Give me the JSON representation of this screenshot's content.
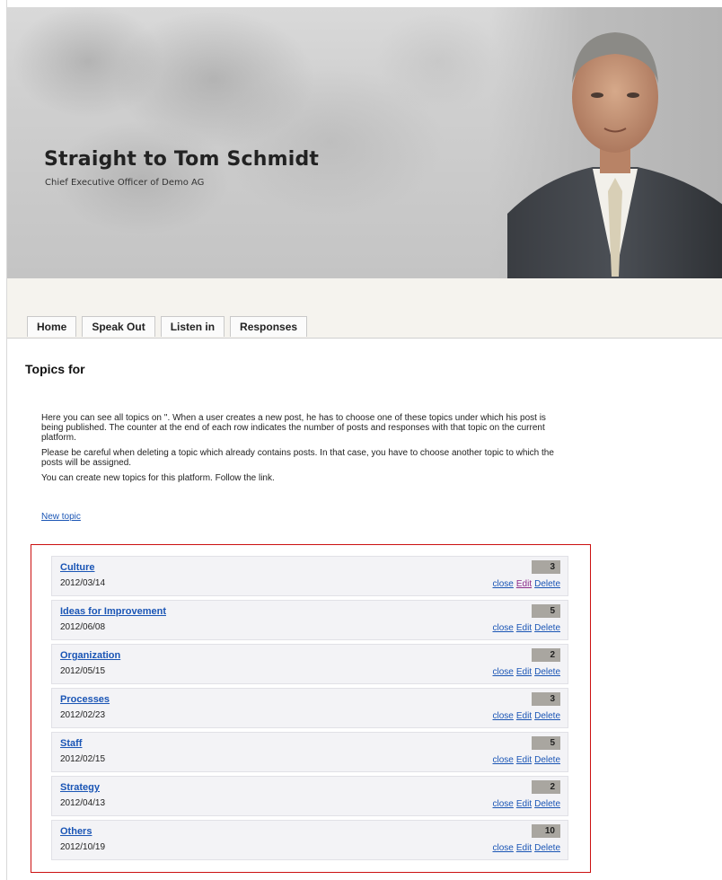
{
  "header": {
    "title": "Straight to Tom Schmidt",
    "subtitle": "Chief Executive Officer of Demo AG"
  },
  "nav": {
    "tabs": [
      {
        "label": "Home"
      },
      {
        "label": "Speak Out"
      },
      {
        "label": "Listen in"
      },
      {
        "label": "Responses"
      }
    ]
  },
  "main": {
    "title": "Topics for",
    "intro": [
      "Here you can see all topics on ''. When a user creates a new post, he has to choose one of these topics under which his post is being published. The counter at the end of each row indicates the number of posts and responses with that topic on the current platform.",
      "Please be careful when deleting a topic which already contains posts. In that case, you have to choose another topic to which the posts will be assigned.",
      "You can create new topics for this platform. Follow the link."
    ],
    "new_topic_link": "New topic",
    "actions": {
      "close": "close",
      "edit": "Edit",
      "delete": "Delete"
    },
    "topics": [
      {
        "name": "Culture",
        "date": "2012/03/14",
        "count": "3"
      },
      {
        "name": "Ideas for Improvement",
        "date": "2012/06/08",
        "count": "5"
      },
      {
        "name": "Organization",
        "date": "2012/05/15",
        "count": "2"
      },
      {
        "name": "Processes",
        "date": "2012/02/23",
        "count": "3"
      },
      {
        "name": "Staff",
        "date": "2012/02/15",
        "count": "5"
      },
      {
        "name": "Strategy",
        "date": "2012/04/13",
        "count": "2"
      },
      {
        "name": "Others",
        "date": "2012/10/19",
        "count": "10"
      }
    ]
  },
  "colors": {
    "link": "#1a55b5",
    "highlight_border": "#cc1111",
    "count_badge": "#a9a6a0"
  }
}
